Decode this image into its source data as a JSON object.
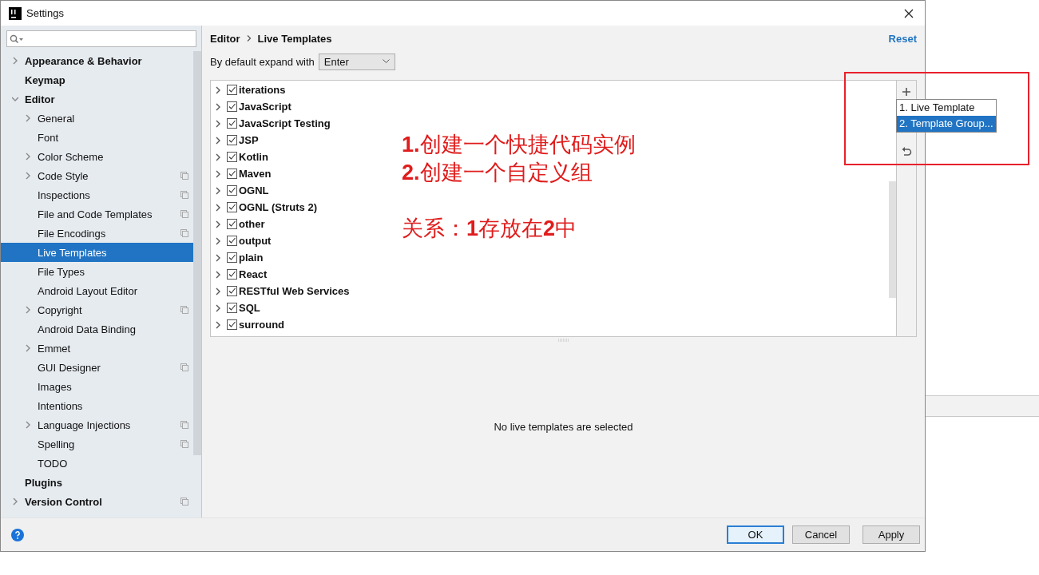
{
  "window": {
    "title": "Settings"
  },
  "sidebar": {
    "items": [
      {
        "label": "Appearance & Behavior",
        "expanded": false,
        "scoped": false
      },
      {
        "label": "Keymap",
        "scoped": false
      },
      {
        "label": "Editor",
        "expanded": true,
        "scoped": false,
        "children": [
          {
            "label": "General",
            "expanded": false,
            "scoped": false,
            "selected": false
          },
          {
            "label": "Font",
            "scoped": false,
            "selected": false
          },
          {
            "label": "Color Scheme",
            "expanded": false,
            "scoped": false,
            "selected": false
          },
          {
            "label": "Code Style",
            "expanded": false,
            "scoped": true,
            "selected": false
          },
          {
            "label": "Inspections",
            "scoped": true,
            "selected": false
          },
          {
            "label": "File and Code Templates",
            "scoped": true,
            "selected": false
          },
          {
            "label": "File Encodings",
            "scoped": true,
            "selected": false
          },
          {
            "label": "Live Templates",
            "scoped": false,
            "selected": true
          },
          {
            "label": "File Types",
            "scoped": false,
            "selected": false
          },
          {
            "label": "Android Layout Editor",
            "scoped": false,
            "selected": false
          },
          {
            "label": "Copyright",
            "expanded": false,
            "scoped": true,
            "selected": false
          },
          {
            "label": "Android Data Binding",
            "scoped": false,
            "selected": false
          },
          {
            "label": "Emmet",
            "expanded": false,
            "scoped": false,
            "selected": false
          },
          {
            "label": "GUI Designer",
            "scoped": true,
            "selected": false
          },
          {
            "label": "Images",
            "scoped": false,
            "selected": false
          },
          {
            "label": "Intentions",
            "scoped": false,
            "selected": false
          },
          {
            "label": "Language Injections",
            "expanded": false,
            "scoped": true,
            "selected": false
          },
          {
            "label": "Spelling",
            "scoped": true,
            "selected": false
          },
          {
            "label": "TODO",
            "scoped": false,
            "selected": false
          }
        ]
      },
      {
        "label": "Plugins",
        "scoped": false
      },
      {
        "label": "Version Control",
        "expanded": false,
        "scoped": true
      }
    ]
  },
  "breadcrumb": [
    "Editor",
    "Live Templates"
  ],
  "reset_link": "Reset",
  "expand_with": {
    "label": "By default expand with",
    "value": "Enter"
  },
  "templates": [
    {
      "label": "iterations",
      "checked": true,
      "expanded": false
    },
    {
      "label": "JavaScript",
      "checked": true,
      "expanded": false
    },
    {
      "label": "JavaScript Testing",
      "checked": true,
      "expanded": false
    },
    {
      "label": "JSP",
      "checked": true,
      "expanded": false
    },
    {
      "label": "Kotlin",
      "checked": true,
      "expanded": false
    },
    {
      "label": "Maven",
      "checked": true,
      "expanded": false
    },
    {
      "label": "OGNL",
      "checked": true,
      "expanded": false
    },
    {
      "label": "OGNL (Struts 2)",
      "checked": true,
      "expanded": false
    },
    {
      "label": "other",
      "checked": true,
      "expanded": false
    },
    {
      "label": "output",
      "checked": true,
      "expanded": false
    },
    {
      "label": "plain",
      "checked": true,
      "expanded": false
    },
    {
      "label": "React",
      "checked": true,
      "expanded": false
    },
    {
      "label": "RESTful Web Services",
      "checked": true,
      "expanded": false
    },
    {
      "label": "SQL",
      "checked": true,
      "expanded": false
    },
    {
      "label": "surround",
      "checked": true,
      "expanded": false
    }
  ],
  "add_menu": [
    {
      "label": "1. Live Template",
      "selected": false
    },
    {
      "label": "2. Template Group...",
      "selected": true
    }
  ],
  "annotation": {
    "lines": [
      "**1.**创建一个快捷代码实例",
      "**2.**创建一个自定义组"
    ],
    "relation": "关系：**1**存放在**2**中"
  },
  "detail_message": "No live templates are selected",
  "buttons": [
    {
      "label": "OK",
      "kind": "default"
    },
    {
      "label": "Cancel",
      "kind": "normal"
    },
    {
      "label": "Apply",
      "kind": "normal"
    }
  ]
}
